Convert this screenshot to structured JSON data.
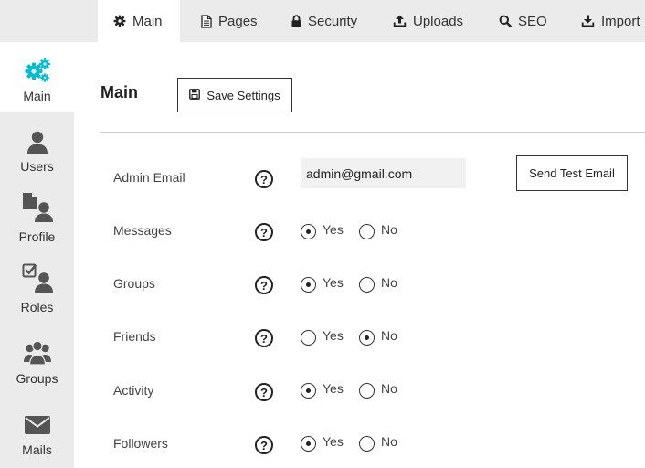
{
  "tabs": [
    {
      "label": "Main",
      "icon": "gear-icon",
      "active": true
    },
    {
      "label": "Pages",
      "icon": "document-icon",
      "active": false
    },
    {
      "label": "Security",
      "icon": "lock-icon",
      "active": false
    },
    {
      "label": "Uploads",
      "icon": "upload-icon",
      "active": false
    },
    {
      "label": "SEO",
      "icon": "search-icon",
      "active": false
    },
    {
      "label": "Import",
      "icon": "download-icon",
      "active": false
    }
  ],
  "sidebar": {
    "items": [
      {
        "label": "Main",
        "icon": "gears-icon",
        "active": true
      },
      {
        "label": "Users",
        "icon": "user-icon",
        "active": false
      },
      {
        "label": "Profile",
        "icon": "profile-icon",
        "active": false
      },
      {
        "label": "Roles",
        "icon": "roles-icon",
        "active": false
      },
      {
        "label": "Groups",
        "icon": "group-icon",
        "active": false
      },
      {
        "label": "Mails",
        "icon": "envelope-icon",
        "active": false
      }
    ]
  },
  "main": {
    "title": "Main",
    "save_label": "Save Settings",
    "admin_email": {
      "label": "Admin Email",
      "value": "admin@gmail.com",
      "test_button": "Send Test Email"
    },
    "help_symbol": "?",
    "yes_label": "Yes",
    "no_label": "No",
    "options": [
      {
        "label": "Messages",
        "value": "Yes"
      },
      {
        "label": "Groups",
        "value": "Yes"
      },
      {
        "label": "Friends",
        "value": "No"
      },
      {
        "label": "Activity",
        "value": "Yes"
      },
      {
        "label": "Followers",
        "value": "Yes"
      }
    ]
  },
  "colors": {
    "accent": "#00bcd4",
    "panel_bg": "#ebebeb",
    "icon_gray": "#555555"
  }
}
